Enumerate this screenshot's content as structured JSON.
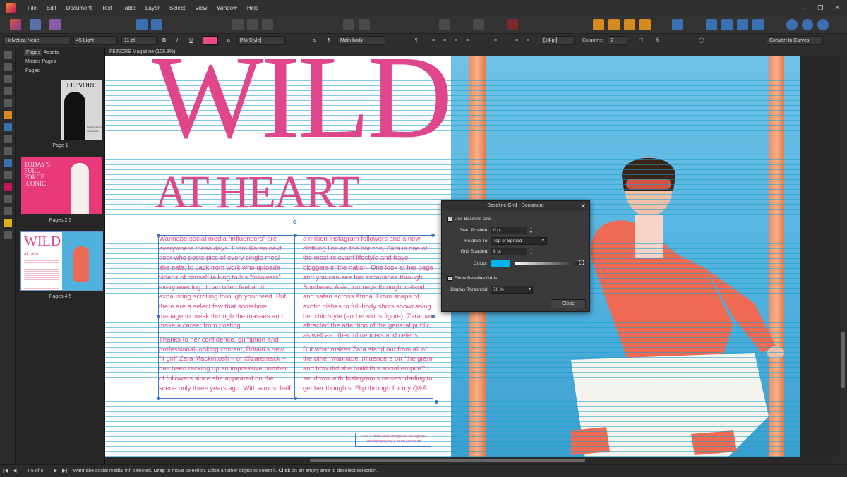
{
  "menu": [
    "File",
    "Edit",
    "Document",
    "Text",
    "Table",
    "Layer",
    "Select",
    "View",
    "Window",
    "Help"
  ],
  "context_toolbar": {
    "font_family": "Helvetica Neue",
    "font_style": "45 Light",
    "font_size": "11 pt",
    "underline": "U",
    "char_style": "[No Style]",
    "para_style": "Main body",
    "leading": "[14 pt]",
    "columns_label": "Columns:",
    "columns_value": "2",
    "convert_button": "Convert to Curves"
  },
  "pages_panel": {
    "tabs": [
      "Pages",
      "Assets"
    ],
    "master_pages": "Master Pages",
    "pages": "Pages",
    "page_labels": [
      "Page 1",
      "Pages 2,3",
      "Pages 4,5"
    ],
    "thumb1": {
      "title": "FEINDRE",
      "sub": "DESIGNER SPECIAL"
    },
    "thumb2": {
      "text": "TODAY'S FULL FORCE ICONIC"
    },
    "thumb3": {
      "title": "WILD",
      "sub": "at heart"
    }
  },
  "document_tab": "FEINDRE Magazine (108.8%)",
  "spread": {
    "headline": "WILD",
    "subheadline": "AT HEART",
    "col1": [
      "Wannabe social media “influencers” are",
      "everywhere these days. From Karen next",
      "door who posts pics of every single meal",
      "she eats, to Jack from work who uploads",
      "videos of himself talking to his “followers”",
      "every evening, it can often feel a bit",
      "exhausting scrolling through your feed. But",
      "there are a select few that somehow",
      "manage to break through the masses and",
      "make a career from posting.",
      "Thanks to her confidence, gumption and",
      "professional-looking content, Britain’s new",
      "“it girl” Zara Mackintosh – or @zaramack –",
      "has been racking up an impressive number",
      "of followers since she appeared on the",
      "scene only three years ago. With almost half"
    ],
    "col2": [
      "a million Instagram followers and a new",
      "clothing line on the horizon, Zara is one of",
      "the most relevant lifestyle and travel",
      "bloggers in the nation. One look at her page",
      "and you can see her escapades through",
      "Southeast Asia, journeys through Iceland",
      "and safari across Africa. From snaps of",
      "exotic dishes to full-body shots showcasing",
      "her chic style (and envious figure), Zara has",
      "attracted the attention of the general public",
      "as well as other influencers and celebs.",
      "But what makes Zara stand out from all of",
      "the other wannabe influencers on “the gram”",
      "and how did she build this social empire? I",
      "sat down with Instagram’s newest darling to",
      "get her thoughts. Flip through for my Q&A."
    ],
    "caption_line1": "Zara's most liked image on Instagram",
    "caption_line2": "Photography by Calum Hickman"
  },
  "dialog": {
    "title": "Baseline Grid - Document",
    "use_baseline_grid": "Use Baseline Grid",
    "start_position_label": "Start Position:",
    "start_position": "0 pt",
    "relative_to_label": "Relative To:",
    "relative_to": "Top of Spread",
    "grid_spacing_label": "Grid Spacing:",
    "grid_spacing": "8 pt",
    "colour_label": "Colour:",
    "colour": "#00b5ee",
    "show_baseline_grids": "Show Baseline Grids",
    "display_threshold_label": "Display Threshold:",
    "display_threshold": "70 %",
    "close": "Close"
  },
  "status": {
    "page_indicator": "4,5 of 5",
    "sel_prefix": "'Wannabe social media 'inf' selected. ",
    "drag": "Drag",
    "drag_rest": " to move selection. ",
    "click": "Click",
    "click_rest": " another object to select it. ",
    "click2": "Click",
    "click2_rest": " on an empty area to deselect selection."
  }
}
